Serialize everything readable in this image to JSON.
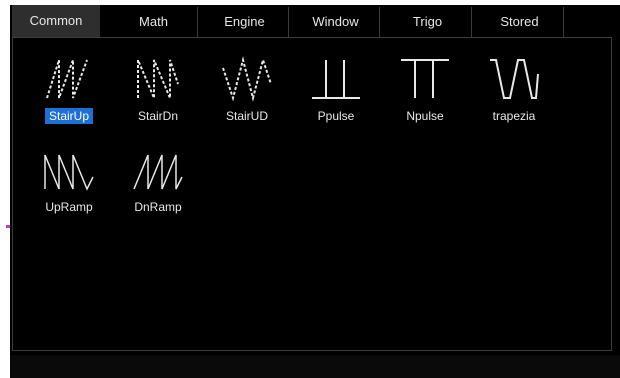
{
  "tabs": [
    {
      "label": "Common"
    },
    {
      "label": "Math"
    },
    {
      "label": "Engine"
    },
    {
      "label": "Window"
    },
    {
      "label": "Trigo"
    },
    {
      "label": "Stored"
    }
  ],
  "active_tab": "Common",
  "waveforms": [
    {
      "label": "StairUp",
      "icon": "stair-up-icon",
      "selected": true
    },
    {
      "label": "StairDn",
      "icon": "stair-down-icon",
      "selected": false
    },
    {
      "label": "StairUD",
      "icon": "stair-updown-icon",
      "selected": false
    },
    {
      "label": "Ppulse",
      "icon": "positive-pulse-icon",
      "selected": false
    },
    {
      "label": "Npulse",
      "icon": "negative-pulse-icon",
      "selected": false
    },
    {
      "label": "trapezia",
      "icon": "trapezia-icon",
      "selected": false
    },
    {
      "label": "UpRamp",
      "icon": "up-ramp-icon",
      "selected": false
    },
    {
      "label": "DnRamp",
      "icon": "down-ramp-icon",
      "selected": false
    }
  ],
  "colors": {
    "background": "#000000",
    "active_tab": "#2e2e2e",
    "selection": "#1e6fd6",
    "text": "#e8e8e8"
  }
}
